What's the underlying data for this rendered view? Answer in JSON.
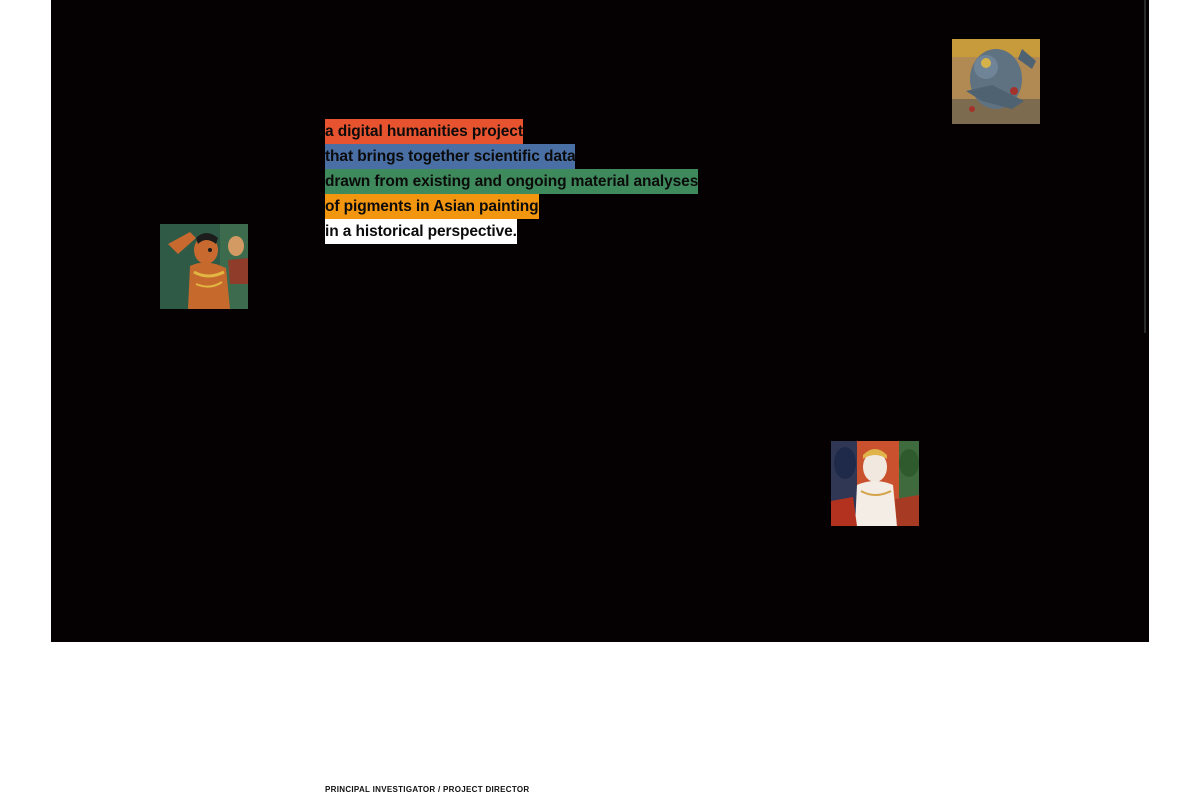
{
  "hero": {
    "background": "#050103",
    "tagline": [
      {
        "text": "a digital humanities project",
        "color": "#e8532f"
      },
      {
        "text": "that brings together scientific data",
        "color": "#4a6fa5"
      },
      {
        "text": "drawn from existing and ongoing material analyses",
        "color": "#3f8a5c"
      },
      {
        "text": "of pigments in Asian painting",
        "color": "#f3960f"
      },
      {
        "text": "in a historical perspective.",
        "color": "#ffffff"
      }
    ],
    "thumbnails": [
      {
        "icon": "painting-figure-blue-deity-icon"
      },
      {
        "icon": "painting-figure-dancer-icon"
      },
      {
        "icon": "painting-figure-group-icon"
      }
    ]
  },
  "footer": {
    "section_label": "PRINCIPAL INVESTIGATOR / PROJECT DIRECTOR"
  }
}
